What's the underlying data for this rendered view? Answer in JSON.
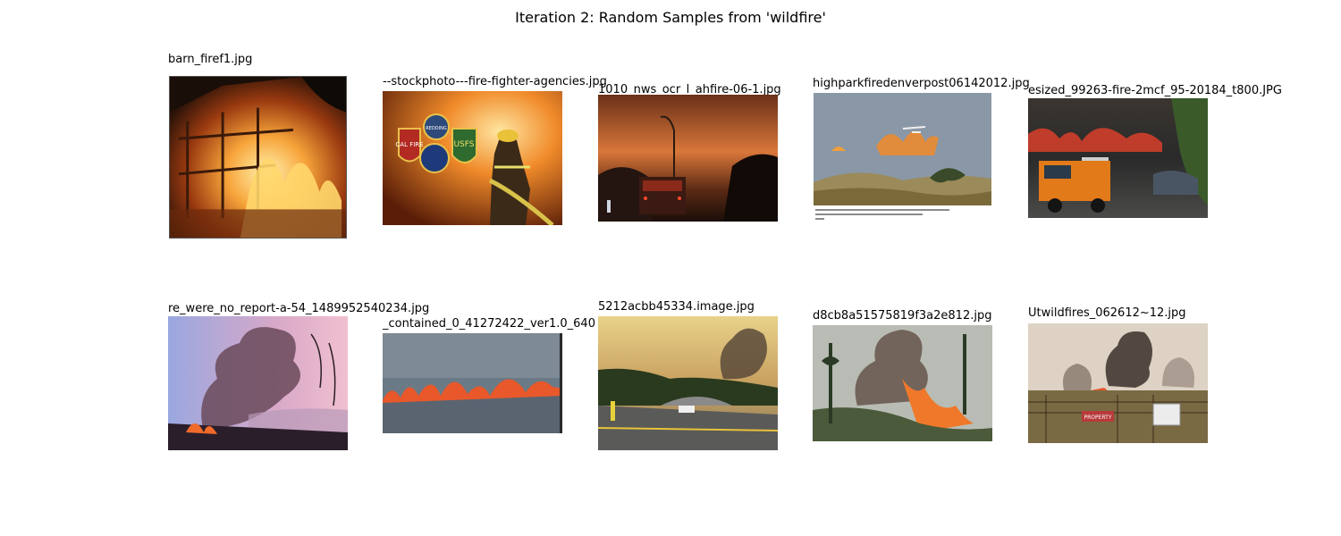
{
  "figure": {
    "title": "Iteration 2: Random Samples from 'wildfire'"
  },
  "samples": [
    {
      "filename": "barn_firef1.jpg",
      "scene": "burning barn at night"
    },
    {
      "filename": "--stockphoto---fire-fighter-agencies.jpg",
      "scene": "firefighter with hose and agency badges",
      "badges": [
        "REDDING",
        "CAL FIRE",
        "USFS"
      ]
    },
    {
      "filename": "1010_nws_ocr_l_ahfire-06-1.jpg",
      "scene": "fire truck under smoky orange sky"
    },
    {
      "filename": "highparkfiredenverpost06142012.jpg",
      "scene": "helicopter over hillside flames"
    },
    {
      "filename": "esized_99263-fire-2mcf_95-20184_t800.JPG",
      "scene": "orange fire engine beside flames"
    },
    {
      "filename": "re_were_no_report-a-54_1489952540234.jpg",
      "scene": "pink smoke plume over trees"
    },
    {
      "filename": "_contained_0_41272422_ver1.0_640",
      "scene": "line of flames in grass"
    },
    {
      "filename": "5212acbb45334.image.jpg",
      "scene": "road with smoke column"
    },
    {
      "filename": "d8cb8a51575819f3a2e812.jpg",
      "scene": "smoke column and flames on hillside"
    },
    {
      "filename": "Utwildfires_062612~12.jpg",
      "scene": "smoke plumes behind fence",
      "sign_text": "PROPERTY"
    }
  ]
}
